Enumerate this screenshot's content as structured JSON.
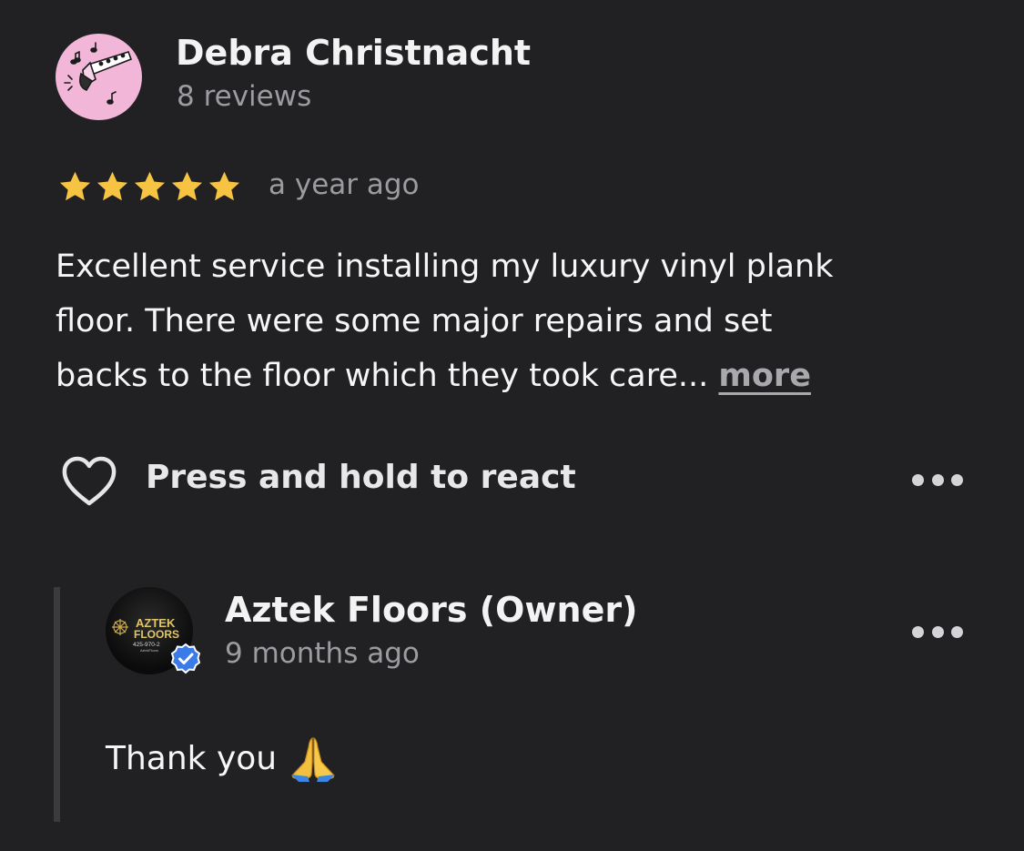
{
  "review": {
    "reviewer_name": "Debra Christnacht",
    "reviewer_reviews": "8 reviews",
    "avatar_icon": "clarinet-music-notes-icon",
    "rating": 5,
    "rating_max": 5,
    "time": "a year ago",
    "text_lines": [
      "Excellent service installing my luxury vinyl plank",
      "floor. There were some major repairs and set",
      "backs to the floor which they took care..."
    ],
    "more_label": "more",
    "react_label": "Press and hold to react",
    "react_icon": "heart-outline-icon",
    "menu_icon": "more-horizontal-icon"
  },
  "owner_reply": {
    "name": "Aztek Floors (Owner)",
    "time": "9 months ago",
    "text": "Thank you",
    "emoji_icon": "folded-hands-icon",
    "avatar_logo": {
      "line1": "AZTEK",
      "line2": "FLOORS",
      "line3": "425-970-2",
      "line4": "AztekFloors"
    },
    "verified_icon": "verified-check-icon",
    "menu_icon": "more-horizontal-icon"
  },
  "colors": {
    "background": "#212124",
    "star": "#f6c343",
    "secondary_text": "#9b9ba0",
    "verified": "#3b7be8",
    "avatar_bg": "#f2b6d8"
  }
}
